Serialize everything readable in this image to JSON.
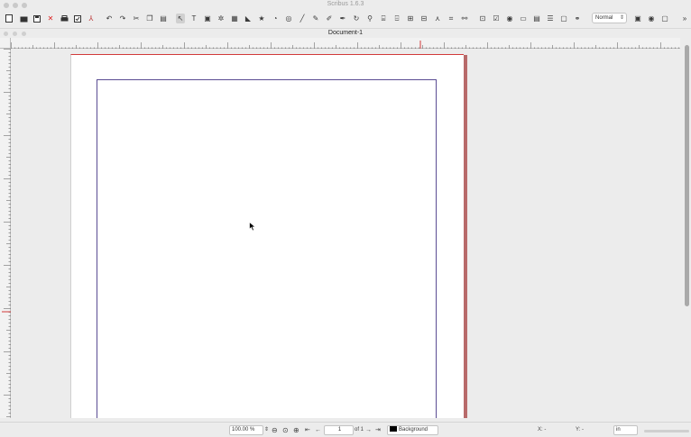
{
  "app": {
    "title": "Scribus 1.6.3"
  },
  "document": {
    "title": "Document-1"
  },
  "toolbar": {
    "mode_value": "Normal",
    "icons": [
      "new-document-icon",
      "open-icon",
      "save-icon",
      "close-icon",
      "print-icon",
      "preflight-icon",
      "export-pdf-icon",
      "undo-icon",
      "redo-icon",
      "cut-icon",
      "copy-icon",
      "paste-icon",
      "select-icon",
      "text-frame-icon",
      "image-frame-icon",
      "render-frame-icon",
      "table-icon",
      "shape-icon",
      "polygon-icon",
      "arc-icon",
      "spiral-icon",
      "line-icon",
      "bezier-icon",
      "freehand-icon",
      "calligraphic-icon",
      "rotate-icon",
      "zoom-icon",
      "edit-contents-icon",
      "edit-text-icon",
      "link-frames-icon",
      "unlink-frames-icon",
      "measure-icon",
      "copy-properties-icon",
      "eyedropper-icon",
      "pdf-button-icon",
      "pdf-checkbox-icon",
      "pdf-radio-icon",
      "pdf-textfield-icon",
      "pdf-combobox-icon",
      "pdf-listbox-icon",
      "pdf-text-annotation-icon",
      "pdf-link-annotation-icon"
    ]
  },
  "status": {
    "zoom_value": "100.00 %",
    "page_value": "1",
    "page_of": "of 1",
    "layer_name": "Background",
    "x_label": "X: -",
    "y_label": "Y: -",
    "unit": "in"
  },
  "colors": {
    "margin_guide": "#5a4c93",
    "page_edge": "#d23b3b",
    "ruler_marker": "#d23b3b"
  }
}
